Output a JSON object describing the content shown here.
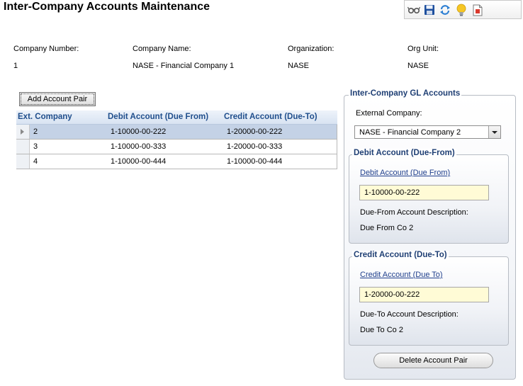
{
  "page": {
    "title": "Inter-Company Accounts Maintenance"
  },
  "toolbar": {
    "icons": [
      "glasses-icon",
      "save-icon",
      "refresh-icon",
      "lightbulb-icon",
      "report-icon"
    ]
  },
  "company_info": {
    "company_number": {
      "label": "Company Number:",
      "value": "1"
    },
    "company_name": {
      "label": "Company Name:",
      "value": "NASE - Financial Company 1"
    },
    "organization": {
      "label": "Organization:",
      "value": "NASE"
    },
    "org_unit": {
      "label": "Org Unit:",
      "value": "NASE"
    }
  },
  "actions": {
    "add_pair": "Add Account Pair",
    "delete_pair": "Delete Account Pair"
  },
  "grid": {
    "columns": [
      "Ext. Company",
      "Debit Account (Due From)",
      "Credit Account (Due-To)"
    ],
    "rows": [
      {
        "ext_company": "2",
        "debit": "1-10000-00-222",
        "credit": "1-20000-00-222",
        "selected": true
      },
      {
        "ext_company": "3",
        "debit": "1-10000-00-333",
        "credit": "1-20000-00-333",
        "selected": false
      },
      {
        "ext_company": "4",
        "debit": "1-10000-00-444",
        "credit": "1-10000-00-444",
        "selected": false
      }
    ]
  },
  "gl_panel": {
    "title": "Inter-Company GL Accounts",
    "external_company_label": "External Company:",
    "external_company_value": "NASE - Financial Company 2",
    "debit": {
      "title": "Debit Account (Due-From)",
      "link": "Debit Account (Due From)",
      "value": "1-10000-00-222",
      "desc_label": "Due-From Account Description:",
      "desc_value": "Due From Co 2"
    },
    "credit": {
      "title": "Credit Account (Due-To)",
      "link": "Credit Account (Due To)",
      "value": "1-20000-00-222",
      "desc_label": "Due-To Account Description:",
      "desc_value": "Due To Co 2"
    }
  },
  "colors": {
    "header_text": "#1f4e8c",
    "panel_title": "#1f3f74",
    "selected_row": "#c4d2e6",
    "input_bg": "#fffbd6"
  }
}
